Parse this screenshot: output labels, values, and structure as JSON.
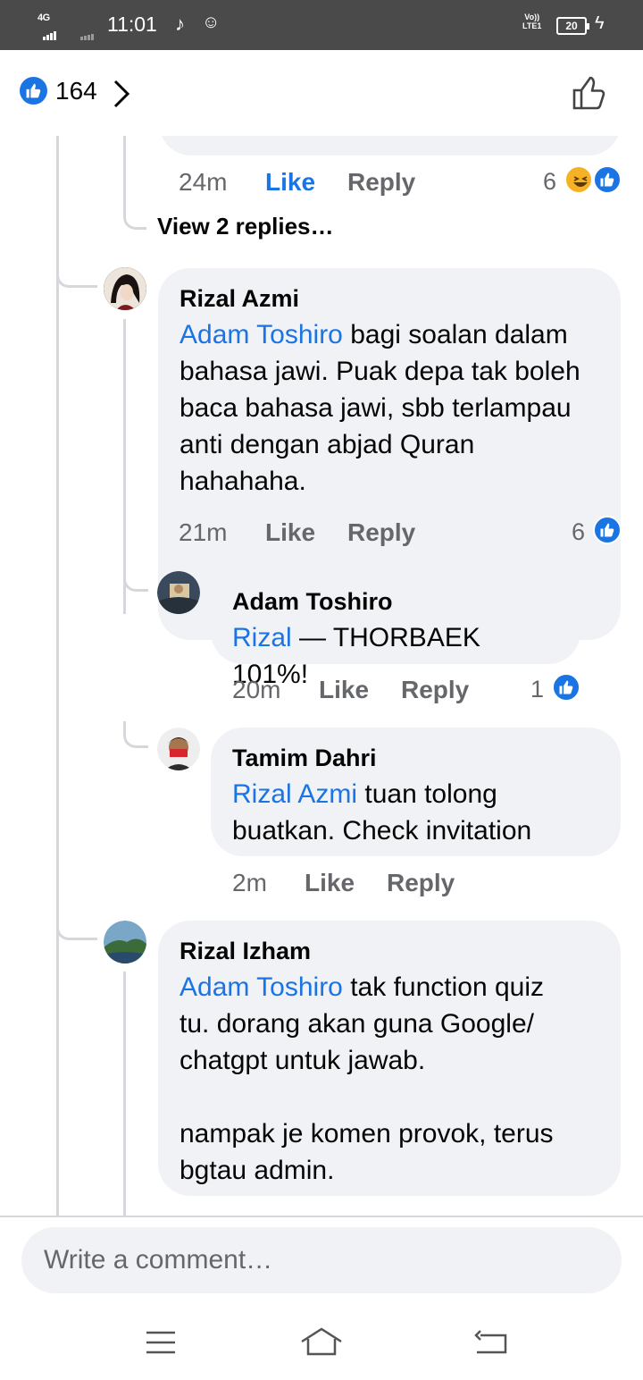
{
  "status_bar": {
    "network": "4G",
    "time": "11:01",
    "volte": "Vo))",
    "lte": "LTE1",
    "battery": "20"
  },
  "header": {
    "reaction_count": "164"
  },
  "comments": [
    {
      "time": "24m",
      "like_label": "Like",
      "reply_label": "Reply",
      "reaction_count": "6",
      "liked": true,
      "reactions": [
        "haha-icon",
        "like-icon"
      ]
    },
    {
      "view_replies": "View 2 replies…"
    },
    {
      "author": "Rizal Azmi",
      "mention": "Adam Toshiro",
      "text_lines": [
        "bagi soalan dalam",
        "bahasa jawi. Puak depa tak boleh",
        "baca bahasa jawi, sbb terlampau",
        "anti dengan abjad Quran",
        "hahahaha."
      ],
      "time": "21m",
      "like_label": "Like",
      "reply_label": "Reply",
      "reaction_count": "6"
    },
    {
      "author": "Adam Toshiro",
      "mention": "Rizal",
      "text": " — THORBAEK 101%!",
      "time": "20m",
      "like_label": "Like",
      "reply_label": "Reply",
      "reaction_count": "1"
    },
    {
      "author": "Tamim Dahri",
      "mention": "Rizal Azmi",
      "text_lines": [
        "tuan tolong",
        "buatkan. Check invitation"
      ],
      "time": "2m",
      "like_label": "Like",
      "reply_label": "Reply"
    },
    {
      "author": "Rizal Izham",
      "mention": "Adam Toshiro",
      "text_lines": [
        "tak function quiz",
        "tu. dorang akan guna Google/",
        "chatgpt untuk jawab.",
        "",
        "nampak je komen provok, terus",
        "bgtau admin."
      ]
    }
  ],
  "composer": {
    "placeholder": "Write a comment…"
  },
  "colors": {
    "accent": "#1b74e4",
    "bubble": "#f0f2f5",
    "meta": "#65676b"
  }
}
